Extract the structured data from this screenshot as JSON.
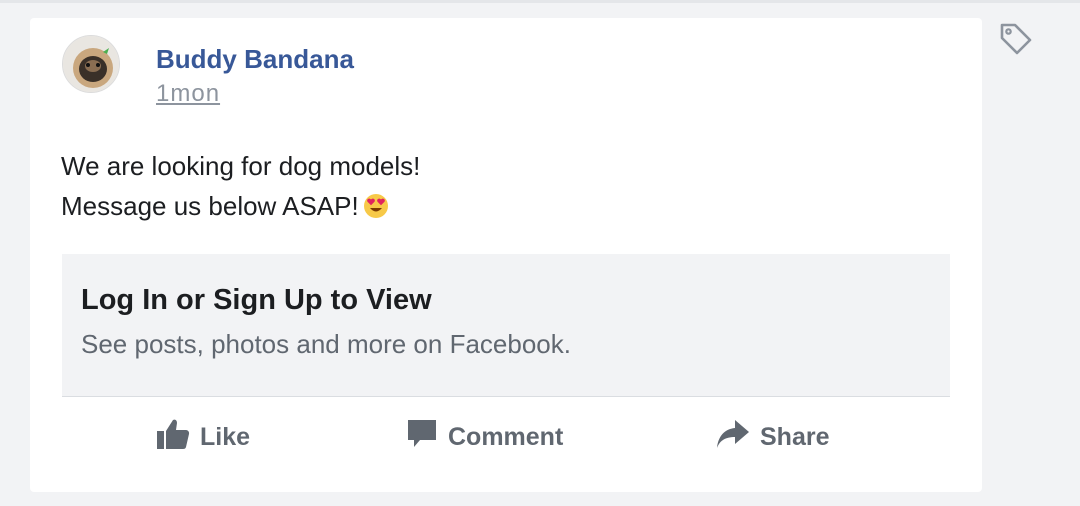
{
  "post": {
    "author": "Buddy Bandana",
    "timestamp": "1mon",
    "text_line1": "We are looking for dog models!",
    "text_line2": "Message us below ASAP!",
    "emoji": "heart-eyes-emoji"
  },
  "login_prompt": {
    "title": "Log In or Sign Up to View",
    "subtitle": "See posts, photos and more on Facebook."
  },
  "actions": {
    "like": "Like",
    "comment": "Comment",
    "share": "Share"
  },
  "icons": {
    "tag": "tag-icon",
    "like": "thumbs-up-icon",
    "comment": "comment-bubble-icon",
    "share": "share-arrow-icon"
  },
  "colors": {
    "author_link": "#385898",
    "muted": "#8d949e",
    "action_text": "#606770",
    "card_bg": "#ffffff",
    "page_bg": "#f2f3f5"
  }
}
